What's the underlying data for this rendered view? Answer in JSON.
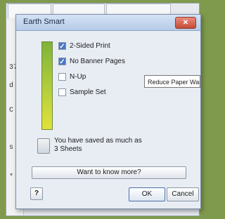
{
  "background_window": {
    "side_marks": [
      "37",
      "d",
      "C",
      "s",
      "*"
    ]
  },
  "dialog": {
    "title": "Earth Smart",
    "close_symbol": "✕",
    "options": [
      {
        "label": "2-Sided Print",
        "checked": true
      },
      {
        "label": "No Banner Pages",
        "checked": true
      },
      {
        "label": "N-Up",
        "checked": false
      },
      {
        "label": "Sample Set",
        "checked": false
      }
    ],
    "tooltip": "Reduce Paper Waste",
    "info": {
      "line1": "You have saved as much as",
      "line2": "3 Sheets"
    },
    "more_button": "Want to know more?",
    "help_button": "?",
    "ok_button": "OK",
    "cancel_button": "Cancel"
  },
  "colors": {
    "desktop_bg": "#7f9a4c",
    "dialog_bg": "#e8edf4",
    "close_red": "#c64b36",
    "bar_green": "#b8d13c"
  },
  "icons": {
    "checkbox_checked": "check-mark",
    "info": "paper-stack-icon"
  }
}
